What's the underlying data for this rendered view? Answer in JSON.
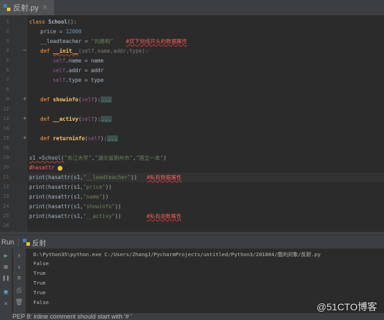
{
  "tab": {
    "filename": "反射.py",
    "close": "×"
  },
  "editor": {
    "lines": [
      {
        "n": "1"
      },
      {
        "n": "2"
      },
      {
        "n": "3"
      },
      {
        "n": "4"
      },
      {
        "n": "5"
      },
      {
        "n": "6"
      },
      {
        "n": "7"
      },
      {
        "n": "8"
      },
      {
        "n": "9"
      },
      {
        "n": "12"
      },
      {
        "n": "13"
      },
      {
        "n": "14"
      },
      {
        "n": "15"
      },
      {
        "n": "18"
      },
      {
        "n": "19"
      },
      {
        "n": "20"
      },
      {
        "n": "21"
      },
      {
        "n": "22"
      },
      {
        "n": "23"
      },
      {
        "n": "24"
      },
      {
        "n": "25"
      },
      {
        "n": "26"
      }
    ],
    "code": {
      "l1_kw": "class ",
      "l1_name": "School",
      "l1_rest": "():",
      "l2_a": "price = ",
      "l2_num": "12000",
      "l3_a": "__leadteacher = ",
      "l3_str": "\"刘昌明\"",
      "l3_cmt": "#双下划线开头的数据属性",
      "l4_kw": "def ",
      "l4_fn": "__init__",
      "l4_rest": "(self,name,addr,type):",
      "l5_self": "self",
      "l5_rest": ".name = name",
      "l6_self": "self",
      "l6_rest": ".addr = addr",
      "l7_self": "self",
      "l7_rest": ".type = type",
      "l9_kw": "def ",
      "l9_fn": "showinfo",
      "l9_p": "(",
      "l9_self": "self",
      "l9_r": "):",
      "l9_box": "...",
      "l13_kw": "def ",
      "l13_fn": "__activy",
      "l13_p": "(",
      "l13_self": "self",
      "l13_r": "):",
      "l13_box": "...",
      "l15_kw": "def ",
      "l15_fn": "returninfo",
      "l15_p": "(",
      "l15_self": "self",
      "l15_r": "):",
      "l15_box": "...",
      "l19_a": "s1 =School(",
      "l19_s1": "\"长江大学\"",
      "l19_c1": ",",
      "l19_s2": "\"湖北省荆州市\"",
      "l19_c2": ",",
      "l19_s3": "\"国立一本\"",
      "l19_r": ")",
      "l20_cmt": "#hasattr",
      "l21_a": "print(hasattr(s1,",
      "l21_str": "\"__leadteacher\"",
      "l21_r": "))",
      "l21_cmt": "#私有数据属性",
      "l22_a": "print(hasattr(s1,",
      "l22_str": "\"price\"",
      "l22_r": "))",
      "l23_a": "print(hasattr(s1,",
      "l23_str": "\"name\"",
      "l23_r": "))",
      "l24_a": "print(hasattr(s1,",
      "l24_str": "\"showinfo\"",
      "l24_r": "))",
      "l25_a": "print(hasattr(s1,",
      "l25_str": "\"__activy\"",
      "l25_r": "))",
      "l25_cmt": "#私有函数属性"
    }
  },
  "run": {
    "label": "Run",
    "config": "反射",
    "command": "D:\\Python35\\python.exe C:/Users/ZhangJ/PycharmProjects/untitled/Python3/201804/面向对象/反射.py",
    "output": [
      "False",
      "True",
      "True",
      "True",
      "False"
    ]
  },
  "status": {
    "message": "PEP 8: inline comment should start with '# '"
  },
  "watermark": "@51CTO博客",
  "colors": {
    "background": "#2b2b2b",
    "keyword": "#cc7832",
    "string": "#6a8759",
    "function": "#ffc66d",
    "comment": "#ff5a5a"
  }
}
